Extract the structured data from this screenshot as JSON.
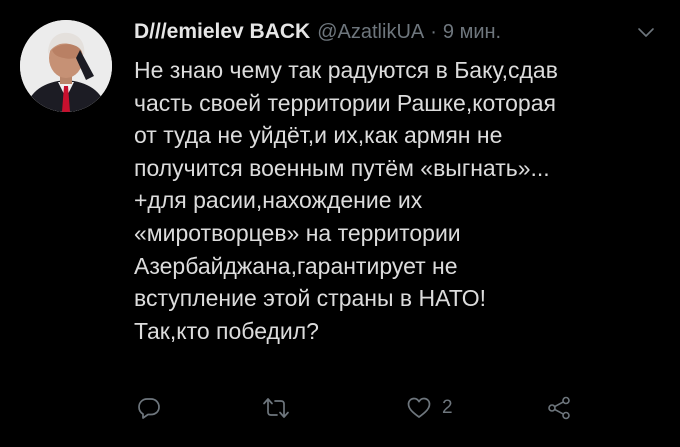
{
  "author": {
    "display_name": "D///emielev BACK",
    "handle": "@AzatlikUA",
    "separator": "·",
    "time": "9 мин."
  },
  "tweet": {
    "lines": [
      "Не знаю чему так радуются в Баку,сдав",
      "часть своей территории Рашке,которая",
      "от туда не уйдёт,и их,как армян не",
      "получится военным путём «выгнать»...",
      "+для расии,нахождение их",
      "«миротворцев» на территории",
      "Азербайджана,гарантирует не",
      "вступление этой страны в НАТО!",
      "Так,кто победил?"
    ]
  },
  "actions": {
    "reply": {
      "icon": "reply-icon"
    },
    "retweet": {
      "icon": "retweet-icon"
    },
    "like": {
      "icon": "heart-icon",
      "count": "2"
    },
    "share": {
      "icon": "share-icon"
    }
  },
  "colors": {
    "background": "#000000",
    "text": "#d9d9d9",
    "muted": "#6e767d"
  }
}
